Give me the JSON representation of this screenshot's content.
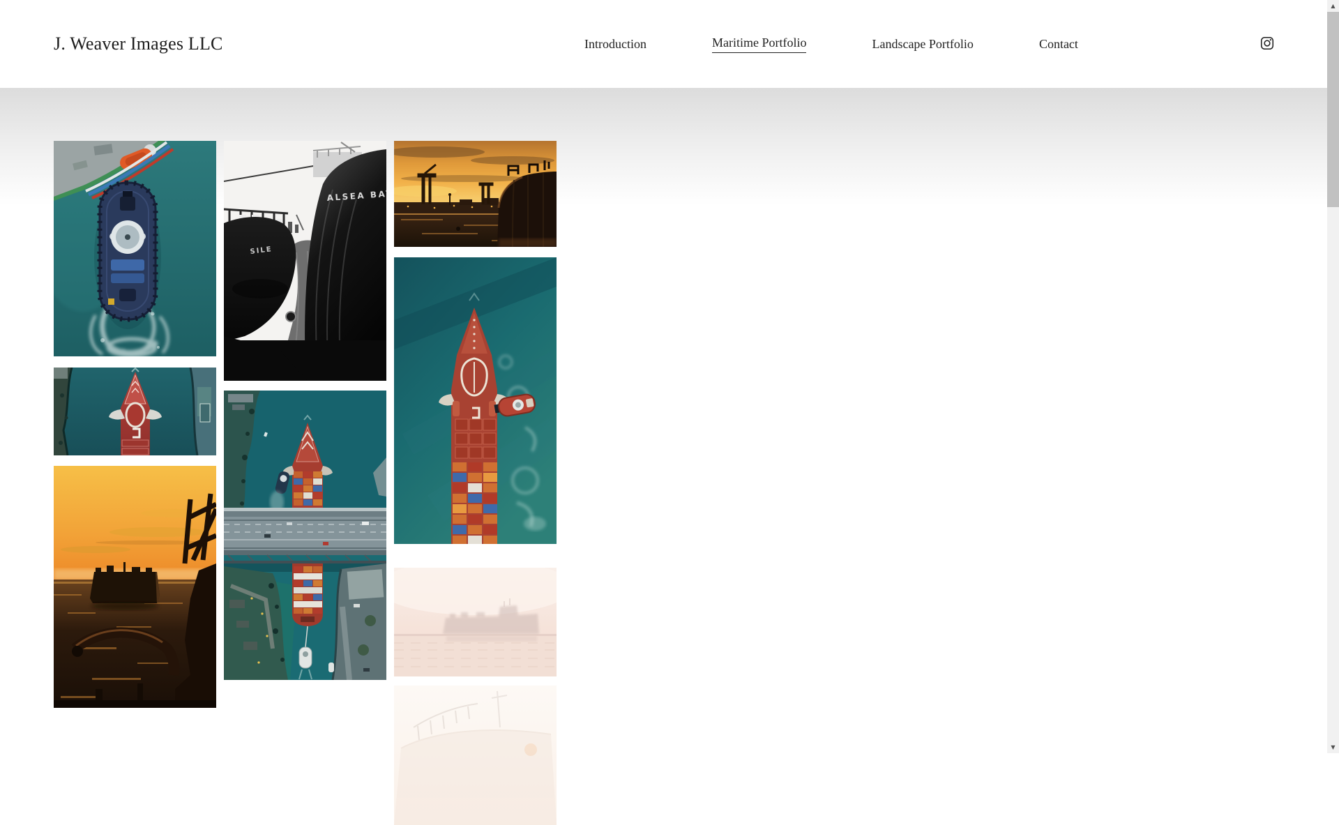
{
  "header": {
    "site_title": "J. Weaver Images LLC",
    "nav": [
      {
        "label": "Introduction",
        "active": false
      },
      {
        "label": "Maritime Portfolio",
        "active": true
      },
      {
        "label": "Landscape Portfolio",
        "active": false
      },
      {
        "label": "Contact",
        "active": false
      }
    ],
    "social": {
      "icon": "instagram-icon"
    }
  },
  "theme": {
    "text_color": "#1c1c1c",
    "header_bg": "#ffffff",
    "content_gradient_top": "#dcdcdc",
    "scrollbar_track": "#f1f1f1",
    "scrollbar_thumb": "#c1c1c1"
  },
  "gallery": {
    "items": [
      {
        "id": "tugboat-aerial",
        "column": 1,
        "description": "Aerial view of dark blue tugboat in teal water beside large ship stern, white wake below"
      },
      {
        "id": "red-ship-bow-dock",
        "column": 1,
        "description": "Aerial top-down of red cargo ship bow between dark shorelines"
      },
      {
        "id": "sunset-car-carrier",
        "column": 1,
        "description": "Golden sunset with silhouetted car-carrier ship and foreground deck railing"
      },
      {
        "id": "bw-ship-hulls",
        "column": 2,
        "description": "Black and white close-up of two ship bows",
        "text_right": "ALSEA BAY",
        "text_left": "SILE"
      },
      {
        "id": "bridge-container-ship",
        "column": 2,
        "description": "Aerial of container ship passing under a highway bridge, towed by tugboat"
      },
      {
        "id": "sunset-harbor-cranes",
        "column": 3,
        "description": "Amber sunset over harbor with silhouetted cranes and large ship bow"
      },
      {
        "id": "container-ship-tug-aerial",
        "column": 3,
        "description": "Aerial of orange container ship with tugboat alongside in deep teal water"
      },
      {
        "id": "hazy-ship-mist",
        "column": 3,
        "description": "Container ship silhouette in pale pink haze"
      },
      {
        "id": "faint-ship-bow",
        "column": 3,
        "description": "Very faint fading-in photo of a ship bow with railings"
      }
    ]
  },
  "scrollbar": {
    "up_glyph": "▲",
    "down_glyph": "▼"
  }
}
